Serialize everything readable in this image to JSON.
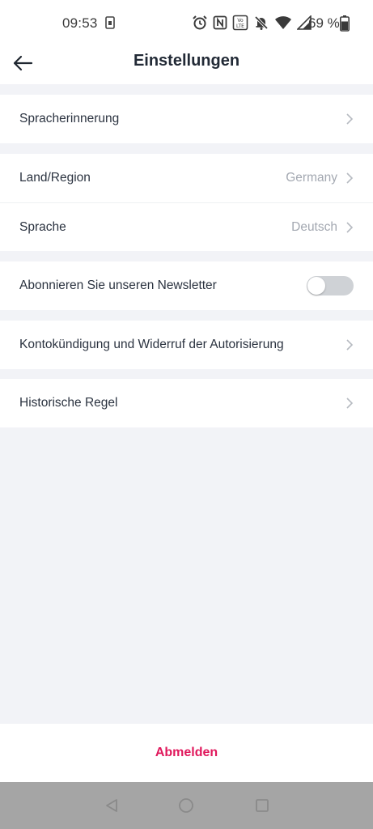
{
  "status_bar": {
    "time": "09:53",
    "battery": "69 %",
    "icons": [
      "alarm-icon",
      "nfc-icon",
      "volte-icon",
      "mute-icon",
      "wifi-icon",
      "signal-icon",
      "battery-icon"
    ]
  },
  "header": {
    "title": "Einstellungen",
    "back_icon": "arrow-left-icon"
  },
  "settings": {
    "voice_reminder": "Spracherinnerung",
    "country_region": {
      "label": "Land/Region",
      "value": "Germany"
    },
    "language": {
      "label": "Sprache",
      "value": "Deutsch"
    },
    "newsletter": {
      "label": "Abonnieren Sie unseren Newsletter",
      "enabled": false
    },
    "account_cancellation": "Kontokündigung und Widerruf der Autorisierung",
    "historical_rule": "Historische Regel"
  },
  "logout": {
    "label": "Abmelden",
    "color": "#e0185c"
  },
  "nav_bar": {
    "back": "nav-back-icon",
    "home": "nav-home-icon",
    "recents": "nav-recents-icon"
  }
}
